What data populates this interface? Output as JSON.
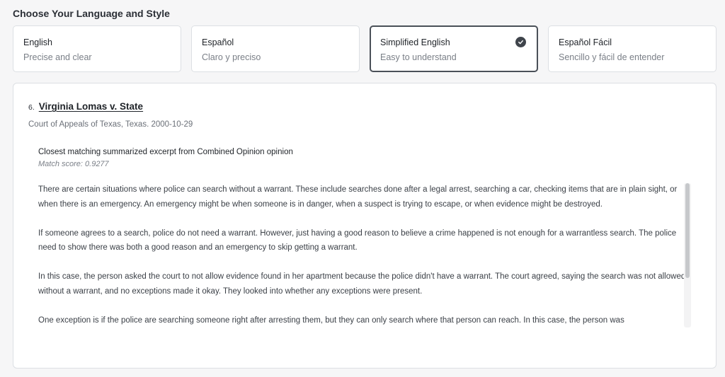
{
  "section": {
    "title": "Choose Your Language and Style"
  },
  "options": [
    {
      "title": "English",
      "subtitle": "Precise and clear",
      "selected": false
    },
    {
      "title": "Español",
      "subtitle": "Claro y preciso",
      "selected": false
    },
    {
      "title": "Simplified English",
      "subtitle": "Easy to understand",
      "selected": true
    },
    {
      "title": "Español Fácil",
      "subtitle": "Sencillo y fácil de entender",
      "selected": false
    }
  ],
  "result": {
    "number": "6.",
    "case_name": "Virginia Lomas v. State",
    "court": "Court of Appeals of Texas, Texas. 2000-10-29",
    "excerpt_heading": "Closest matching summarized excerpt from Combined Opinion opinion",
    "match_score": "Match score: 0.9277",
    "paragraphs": [
      "There are certain situations where police can search without a warrant. These include searches done after a legal arrest, searching a car, checking items that are in plain sight, or when there is an emergency. An emergency might be when someone is in danger, when a suspect is trying to escape, or when evidence might be destroyed.",
      "If someone agrees to a search, police do not need a warrant. However, just having a good reason to believe a crime happened is not enough for a warrantless search. The police need to show there was both a good reason and an emergency to skip getting a warrant.",
      "In this case, the person asked the court to not allow evidence found in her apartment because the police didn't have a warrant. The court agreed, saying the search was not allowed without a warrant, and no exceptions made it okay. They looked into whether any exceptions were present.",
      "One exception is if the police are searching someone right after arresting them, but they can only search where that person can reach. In this case, the person was"
    ]
  },
  "icons": {
    "selected": "check-circle-icon"
  },
  "colors": {
    "selected_border": "#4a5058",
    "background": "#f6f6f7"
  }
}
